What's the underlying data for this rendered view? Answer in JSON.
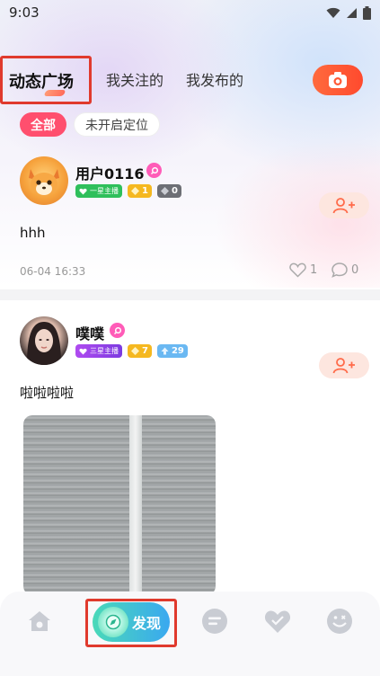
{
  "status_bar": {
    "time": "9:03"
  },
  "tabs": {
    "active": "动态广场",
    "following": "我关注的",
    "mine": "我发布的"
  },
  "filters": {
    "all": "全部",
    "location": "未开启定位"
  },
  "posts": [
    {
      "username": "用户0116",
      "badges": {
        "host": "一星主播",
        "gold_level": "1",
        "diamond_level": "0"
      },
      "text": "hhh",
      "time": "06-04 16:33",
      "likes": "1",
      "comments": "0"
    },
    {
      "username": "噗噗",
      "badges": {
        "host": "三星主播",
        "gold_level": "7",
        "blue_level": "29"
      },
      "text": "啦啦啦啦"
    }
  ],
  "bottom_nav": {
    "discover_label": "发现"
  },
  "colors": {
    "accent_red": "#e03a2d",
    "chip_pink": "#ff4f6e",
    "camera_orange": "#ff5a36",
    "discover_green": "#4ad9b8",
    "discover_blue": "#3aa8f0"
  }
}
